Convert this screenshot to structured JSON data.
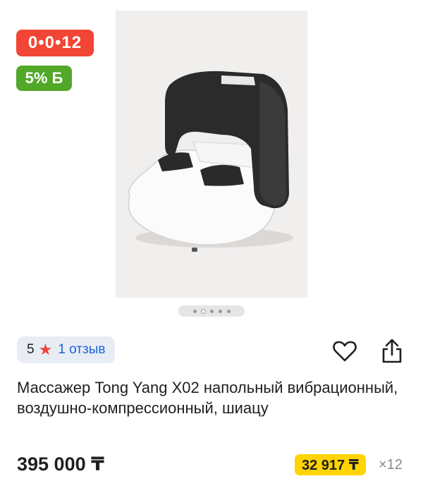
{
  "product": {
    "promo_timer": "0•0•12",
    "bonus": "5% Б",
    "rating_score": "5",
    "reviews_label": "1 отзыв",
    "title": "Массажер Tong Yang X02 напольный вибрационный, воздушно-компрессионный, шиацу",
    "price": "395 000 ₸",
    "installment_price": "32 917 ₸",
    "installment_months": "×12"
  },
  "gallery": {
    "slides_total": 5,
    "active_slide": 2
  },
  "icons": {
    "favorite": "heart-icon",
    "share": "share-icon",
    "rating": "star-icon"
  },
  "colors": {
    "timer_badge": "#f14635",
    "bonus_badge": "#51a829",
    "installment_badge": "#ffd400",
    "link": "#1a64d6",
    "star": "#f1453a"
  }
}
